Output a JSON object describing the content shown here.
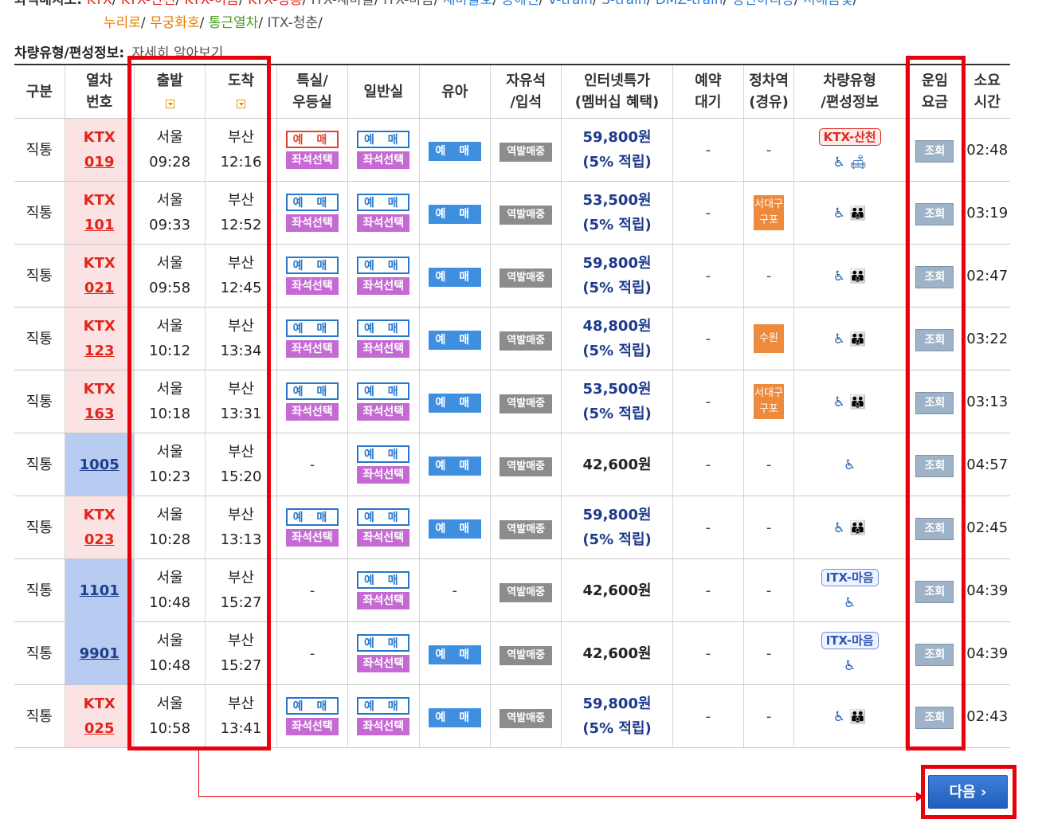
{
  "legend": {
    "label": "좌석배치도:",
    "row1": [
      {
        "text": "KTX",
        "color": "red"
      },
      {
        "text": "KTX-산천",
        "color": "red"
      },
      {
        "text": "KTX-이음",
        "color": "red"
      },
      {
        "text": "KTX-청룡",
        "color": "red"
      },
      {
        "text": "ITX-새마을",
        "color": "gray"
      },
      {
        "text": "ITX-마음",
        "color": "gray"
      },
      {
        "text": "새마을호",
        "color": "blue"
      },
      {
        "text": "공해전",
        "color": "blue"
      },
      {
        "text": "V-train",
        "color": "blue"
      },
      {
        "text": "S-train",
        "color": "blue"
      },
      {
        "text": "DMZ-train",
        "color": "blue"
      },
      {
        "text": "정선아리랑",
        "color": "blue"
      },
      {
        "text": "서해금빛",
        "color": "blue"
      }
    ],
    "row2": [
      {
        "text": "누리로",
        "color": "orange"
      },
      {
        "text": "무궁화호",
        "color": "orange"
      },
      {
        "text": "통근열차",
        "color": "green"
      },
      {
        "text": "ITX-청춘",
        "color": "gray"
      }
    ]
  },
  "info": {
    "label": "차량유형/편성정보:",
    "link": "자세히 알아보기"
  },
  "headers": {
    "type": "구분",
    "trainno_1": "열차",
    "trainno_2": "번호",
    "depart": "출발",
    "arrive": "도착",
    "special_1": "특실/",
    "special_2": "우등실",
    "general": "일반실",
    "infant": "유아",
    "free_1": "자유석",
    "free_2": "/입석",
    "internet_1": "인터넷특가",
    "internet_2": "(멤버십 혜택)",
    "wait_1": "예약",
    "wait_2": "대기",
    "stop_1": "정차역",
    "stop_2": "(경유)",
    "vehicle_1": "차량유형",
    "vehicle_2": "/편성정보",
    "fare_1": "운임",
    "fare_2": "요금",
    "duration_1": "소요",
    "duration_2": "시간"
  },
  "labels": {
    "reserve": "예 매",
    "seat": "좌석선택",
    "station_sale": "역발매중",
    "fare": "조회",
    "dash": "-",
    "accrual": "(5% 적립)"
  },
  "rows": [
    {
      "type": "직통",
      "kind": "KTX",
      "no": "019",
      "dep_st": "서울",
      "dep_t": "09:28",
      "arr_st": "부산",
      "arr_t": "12:16",
      "special": "red",
      "general": true,
      "infant": true,
      "price": "59,800원",
      "accrual": true,
      "wait": "-",
      "stop": "-",
      "vehicle_badge": "KTX-산천",
      "badge_color": "red",
      "icons": "♿ 🛋",
      "dur": "02:48"
    },
    {
      "type": "직통",
      "kind": "KTX",
      "no": "101",
      "dep_st": "서울",
      "dep_t": "09:33",
      "arr_st": "부산",
      "arr_t": "12:52",
      "special": "blue",
      "general": true,
      "infant": true,
      "price": "53,500원",
      "accrual": true,
      "wait": "-",
      "stop": "서대구\n구포",
      "stop_kind": "double",
      "vehicle_badge": "",
      "icons": "♿ 👪",
      "dur": "03:19"
    },
    {
      "type": "직통",
      "kind": "KTX",
      "no": "021",
      "dep_st": "서울",
      "dep_t": "09:58",
      "arr_st": "부산",
      "arr_t": "12:45",
      "special": "blue",
      "general": true,
      "infant": true,
      "price": "59,800원",
      "accrual": true,
      "wait": "-",
      "stop": "-",
      "vehicle_badge": "",
      "icons": "♿ 👪",
      "dur": "02:47"
    },
    {
      "type": "직통",
      "kind": "KTX",
      "no": "123",
      "dep_st": "서울",
      "dep_t": "10:12",
      "arr_st": "부산",
      "arr_t": "13:34",
      "special": "blue",
      "general": true,
      "infant": true,
      "price": "48,800원",
      "accrual": true,
      "wait": "-",
      "stop": "수원",
      "stop_kind": "single",
      "vehicle_badge": "",
      "icons": "♿ 👪",
      "dur": "03:22"
    },
    {
      "type": "직통",
      "kind": "KTX",
      "no": "163",
      "dep_st": "서울",
      "dep_t": "10:18",
      "arr_st": "부산",
      "arr_t": "13:31",
      "special": "blue",
      "general": true,
      "infant": true,
      "price": "53,500원",
      "accrual": true,
      "wait": "-",
      "stop": "서대구\n구포",
      "stop_kind": "double",
      "vehicle_badge": "",
      "icons": "♿ 👪",
      "dur": "03:13"
    },
    {
      "type": "직통",
      "kind": "",
      "no": "1005",
      "dep_st": "서울",
      "dep_t": "10:23",
      "arr_st": "부산",
      "arr_t": "15:20",
      "special": "none",
      "general": true,
      "infant": true,
      "price": "42,600원",
      "accrual": false,
      "wait": "-",
      "stop": "-",
      "vehicle_badge": "",
      "icons": "♿",
      "dur": "04:57"
    },
    {
      "type": "직통",
      "kind": "KTX",
      "no": "023",
      "dep_st": "서울",
      "dep_t": "10:28",
      "arr_st": "부산",
      "arr_t": "13:13",
      "special": "blue",
      "general": true,
      "infant": true,
      "price": "59,800원",
      "accrual": true,
      "wait": "-",
      "stop": "-",
      "vehicle_badge": "",
      "icons": "♿ 👪",
      "dur": "02:45"
    },
    {
      "type": "직통",
      "kind": "",
      "no": "1101",
      "dep_st": "서울",
      "dep_t": "10:48",
      "arr_st": "부산",
      "arr_t": "15:27",
      "special": "none",
      "general": true,
      "infant": false,
      "price": "42,600원",
      "accrual": false,
      "wait": "-",
      "stop": "-",
      "vehicle_badge": "ITX-마음",
      "badge_color": "blue",
      "icons": "♿",
      "dur": "04:39"
    },
    {
      "type": "직통",
      "kind": "",
      "no": "9901",
      "dep_st": "서울",
      "dep_t": "10:48",
      "arr_st": "부산",
      "arr_t": "15:27",
      "special": "none",
      "general": true,
      "infant": true,
      "price": "42,600원",
      "accrual": false,
      "wait": "-",
      "stop": "-",
      "vehicle_badge": "ITX-마음",
      "badge_color": "blue",
      "icons": "♿",
      "dur": "04:39"
    },
    {
      "type": "직통",
      "kind": "KTX",
      "no": "025",
      "dep_st": "서울",
      "dep_t": "10:58",
      "arr_st": "부산",
      "arr_t": "13:41",
      "special": "blue",
      "general": true,
      "infant": true,
      "price": "59,800원",
      "accrual": true,
      "wait": "-",
      "stop": "-",
      "vehicle_badge": "",
      "icons": "♿ 👪",
      "dur": "02:43"
    }
  ],
  "next_button": "다음 ›",
  "colors": {
    "highlight": "#e8000d",
    "ktx_bg": "#fbe3e3",
    "mugunghwa_bg": "#b7ccf0",
    "price": "#1e3a8a"
  }
}
